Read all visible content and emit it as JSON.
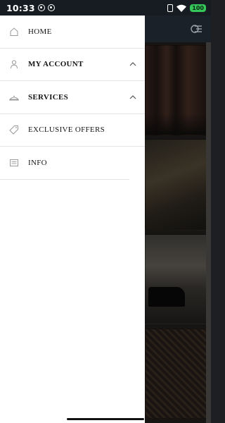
{
  "status_bar": {
    "time": "10:33",
    "battery": "100",
    "icons": [
      "whatsapp-icon",
      "whatsapp-icon",
      "battery-saver-icon",
      "wifi-icon"
    ]
  },
  "menu": {
    "items": [
      {
        "label": "HOME",
        "icon": "home-icon",
        "expandable": false
      },
      {
        "label": "MY ACCOUNT",
        "icon": "user-icon",
        "expandable": true
      },
      {
        "label": "SERVICES",
        "icon": "services-icon",
        "expandable": true
      },
      {
        "label": "EXCLUSIVE OFFERS",
        "icon": "tag-icon",
        "expandable": false
      },
      {
        "label": "INFO",
        "icon": "info-list-icon",
        "expandable": false
      }
    ]
  },
  "colors": {
    "drawer_bg": "#ffffff",
    "status_bar_bg": "#171c22",
    "battery_green": "#35c759",
    "text": "#151515",
    "icon_gray": "#9a9a9a"
  }
}
